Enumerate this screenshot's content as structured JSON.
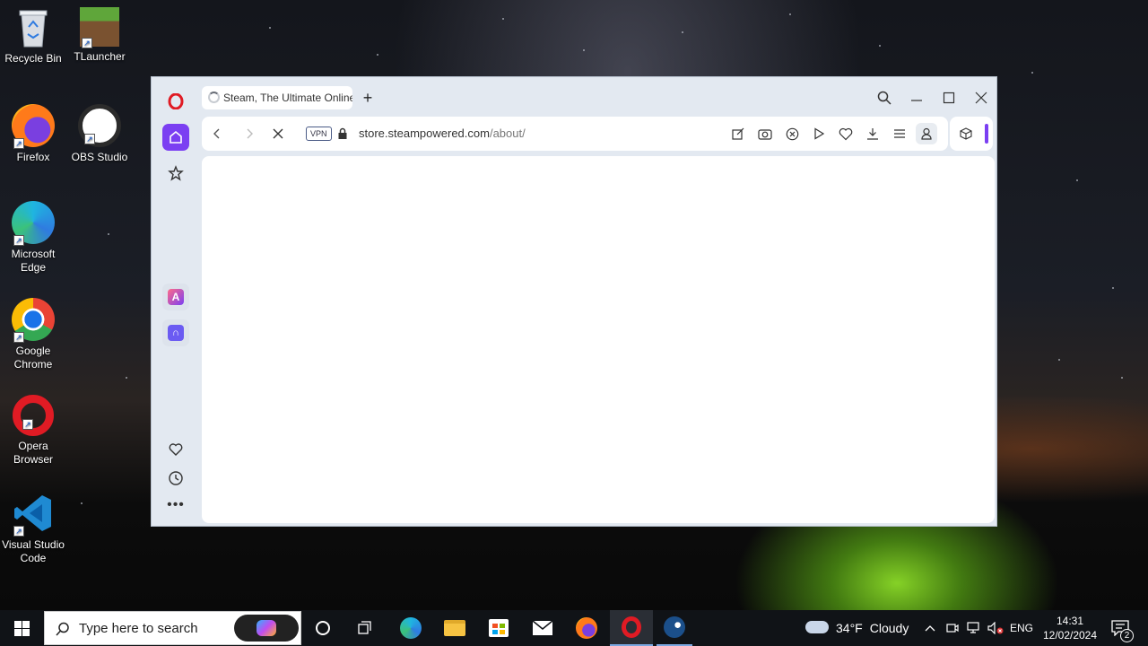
{
  "desktop": {
    "icons": [
      {
        "label": "Recycle Bin",
        "icon": "recycle-bin-icon"
      },
      {
        "label": "TLauncher",
        "icon": "tlauncher-icon"
      },
      {
        "label": "Firefox",
        "icon": "firefox-icon"
      },
      {
        "label": "OBS Studio",
        "icon": "obs-studio-icon"
      },
      {
        "label": "Microsoft Edge",
        "icon": "edge-icon"
      },
      {
        "label": "Google Chrome",
        "icon": "chrome-icon"
      },
      {
        "label": "Opera Browser",
        "icon": "opera-icon"
      },
      {
        "label": "Visual Studio Code",
        "icon": "vscode-icon"
      }
    ]
  },
  "browser": {
    "tab_title": "Steam, The Ultimate Online Game Platform",
    "url_host": "store.steampowered.com",
    "url_path": "/about/",
    "vpn_label": "VPN",
    "accent": "#7b3ff2"
  },
  "taskbar": {
    "search_placeholder": "Type here to search",
    "weather_temp": "34°F",
    "weather_desc": "Cloudy",
    "lang": "ENG",
    "time": "14:31",
    "date": "12/02/2024",
    "notification_count": "2"
  }
}
